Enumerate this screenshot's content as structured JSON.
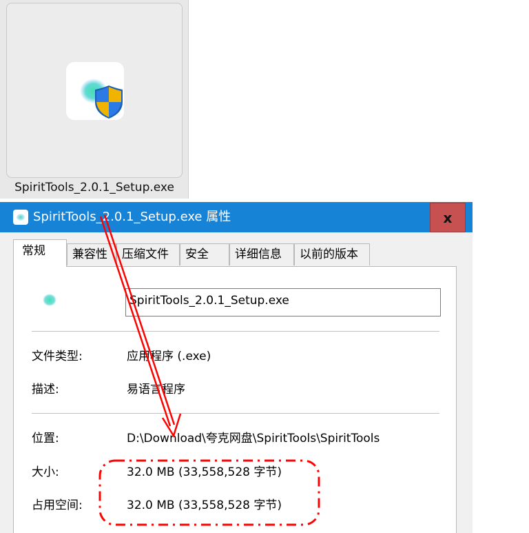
{
  "explorer_tile": {
    "caption": "SpiritTools_2.0.1_Setup.exe"
  },
  "dialog": {
    "title": "SpiritTools_2.0.1_Setup.exe 属性",
    "close_label": "x",
    "tabs": [
      {
        "label": "常规",
        "active": true
      },
      {
        "label": "兼容性",
        "active": false
      },
      {
        "label": "压缩文件",
        "active": false
      },
      {
        "label": "安全",
        "active": false
      },
      {
        "label": "详细信息",
        "active": false
      },
      {
        "label": "以前的版本",
        "active": false
      }
    ],
    "general": {
      "file_name": "SpiritTools_2.0.1_Setup.exe",
      "rows": [
        {
          "label": "文件类型:",
          "value": "应用程序 (.exe)"
        },
        {
          "label": "描述:",
          "value": "易语言程序"
        },
        {
          "label": "位置:",
          "value": "D:\\Download\\夸克网盘\\SpiritTools\\SpiritTools"
        },
        {
          "label": "大小:",
          "value": "32.0 MB (33,558,528 字节)"
        },
        {
          "label": "占用空间:",
          "value": "32.0 MB (33,558,528 字节)"
        }
      ]
    }
  },
  "colors": {
    "titlebar": "#1783d7",
    "close_button": "#c75050",
    "annotation": "#ff0000"
  }
}
